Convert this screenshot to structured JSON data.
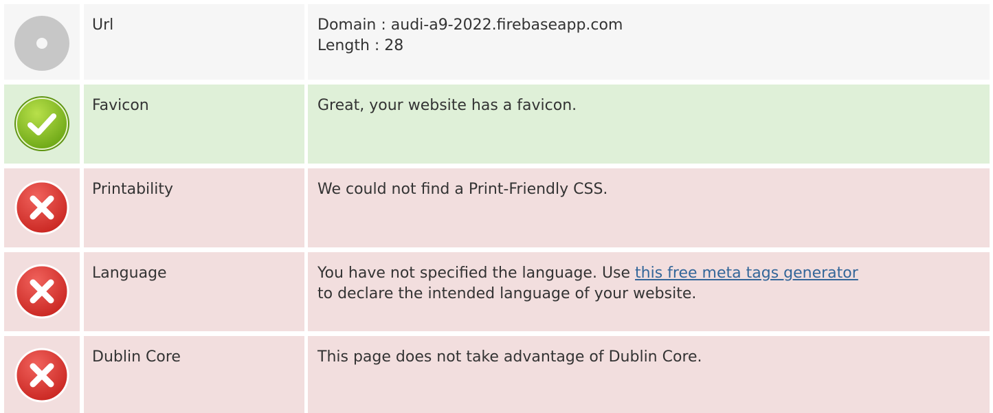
{
  "rows": [
    {
      "status": "neutral",
      "icon": "neutral-circle-icon",
      "label": "Url",
      "lines": [
        "Domain : audi-a9-2022.firebaseapp.com",
        "Length : 28"
      ]
    },
    {
      "status": "pass",
      "icon": "check-circle-icon",
      "label": "Favicon",
      "lines": [
        "Great, your website has a favicon."
      ]
    },
    {
      "status": "fail",
      "icon": "error-x-icon",
      "label": "Printability",
      "lines": [
        "We could not find a Print-Friendly CSS."
      ]
    },
    {
      "status": "fail",
      "icon": "error-x-icon",
      "label": "Language",
      "line1_prefix": "You have not specified the language. Use ",
      "link_text": "this free meta tags generator",
      "line2": "to declare the intended language of your website."
    },
    {
      "status": "fail",
      "icon": "error-x-icon",
      "label": "Dublin Core",
      "lines": [
        "This page does not take advantage of Dublin Core."
      ]
    }
  ],
  "colors": {
    "neutral_bg": "#f6f6f6",
    "pass_bg": "#dff0d8",
    "fail_bg": "#f2dede",
    "link": "#336699"
  }
}
